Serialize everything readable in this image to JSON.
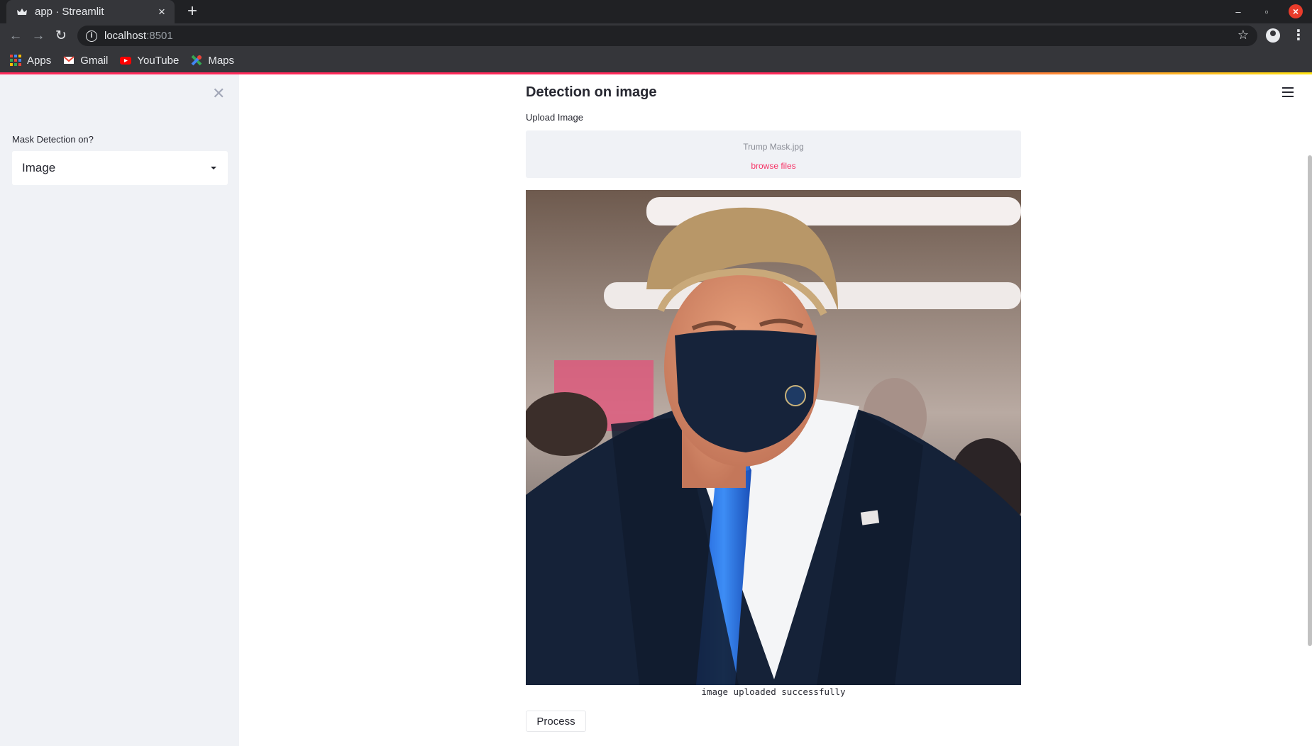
{
  "browser": {
    "tab_title": "app · Streamlit",
    "url_host": "localhost",
    "url_port": ":8501",
    "bookmarks": [
      {
        "label": "Apps",
        "icon": "apps-grid-icon"
      },
      {
        "label": "Gmail",
        "icon": "gmail-icon"
      },
      {
        "label": "YouTube",
        "icon": "youtube-icon"
      },
      {
        "label": "Maps",
        "icon": "maps-icon"
      }
    ]
  },
  "sidebar": {
    "select_label": "Mask Detection on?",
    "select_value": "Image"
  },
  "main": {
    "title": "Detection on image",
    "upload_label": "Upload Image",
    "uploaded_filename": "Trump Mask.jpg",
    "browse_label": "browse files",
    "image_caption": "image uploaded successfully",
    "process_button": "Process"
  },
  "colors": {
    "accent": "#f63366",
    "sidebar_bg": "#f0f2f6",
    "chrome_dark": "#202124",
    "chrome_mid": "#35363a"
  }
}
